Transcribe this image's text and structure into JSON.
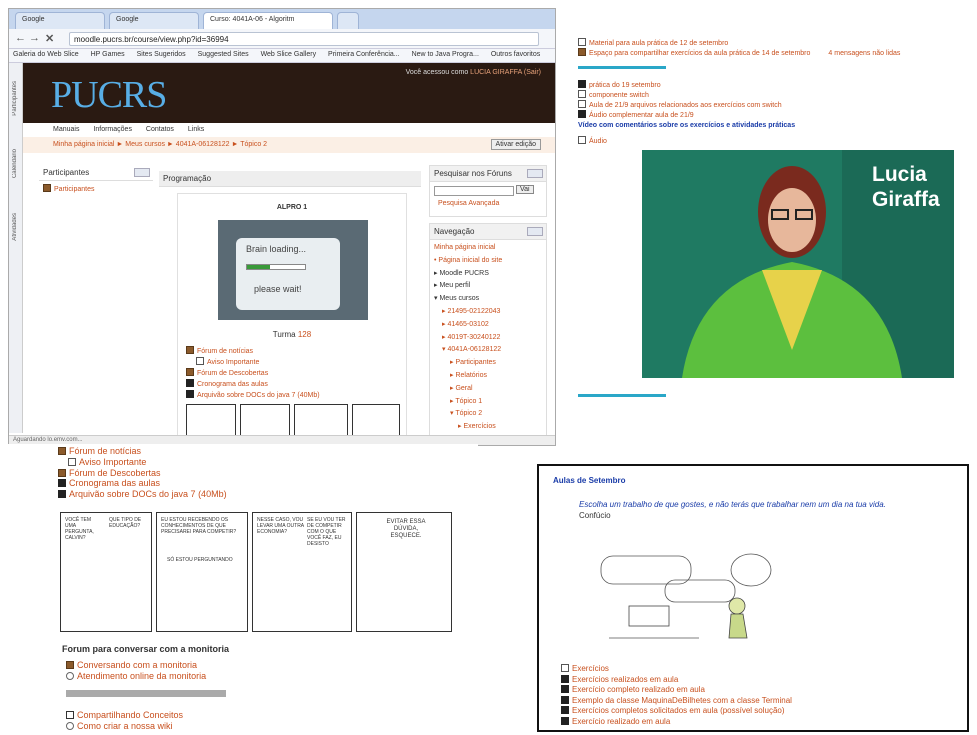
{
  "browser": {
    "tabs": [
      "Google",
      "Google",
      "Curso: 4041A-06 - Algoritm"
    ],
    "url": "moodle.pucrs.br/course/view.php?id=36994",
    "bookmarks": [
      "Galeria do Web Slice",
      "HP Games",
      "Sites Sugeridos",
      "Suggested Sites",
      "Web Slice Gallery",
      "Primeira Conferência...",
      "New to Java Progra...",
      "Outros favoritos"
    ],
    "side_tabs": [
      "Participantes",
      "Calendário",
      "Atividades"
    ],
    "logo": "PUCRS",
    "login_text": "Você acessou como",
    "login_user": "LUCIA GIRAFFA",
    "login_logout": "(Sair)",
    "menu": [
      "Manuais",
      "Informações",
      "Contatos",
      "Links"
    ],
    "breadcrumb": "Minha página inicial ► Meus cursos ► 4041A-06128122 ► Tópico 2",
    "edit_button": "Ativar edição",
    "participants_block": {
      "title": "Participantes",
      "item": "Participantes"
    },
    "programacao": {
      "title": "Programação",
      "course": "ALPRO 1",
      "loading_text": "Brain loading...",
      "wait_text": "please wait!",
      "turma_label": "Turma",
      "turma_number": "128",
      "items": [
        "Fórum de notícias",
        "Aviso Importante",
        "Fórum de Descobertas",
        "Cronograma das aulas",
        "Arquivão sobre DOCs do java 7 (40Mb)"
      ]
    },
    "search_block": {
      "title": "Pesquisar nos Fóruns",
      "button": "Vai",
      "advanced": "Pesquisa Avançada"
    },
    "nav_block": {
      "title": "Navegação",
      "items": [
        "Minha página inicial",
        "Página inicial do site",
        "Moodle PUCRS",
        "Meu perfil",
        "Meus cursos",
        "21495-02122043",
        "41465-03102",
        "4019T-30240122",
        "4041A-06128122",
        "Participantes",
        "Relatórios",
        "Geral",
        "Tópico 1",
        "Tópico 2",
        "Exercícios"
      ]
    },
    "status": "Aguardando lo.emv.com..."
  },
  "panel2": {
    "items": [
      "Material para aula prática de 12 de setembro",
      "Espaço para compartilhar exercícios da aula prática de 14 de setembro",
      "4 mensagens não lidas",
      "prática do 19 setembro",
      "componente switch",
      "Aula de 21/9 arquivos relacionados aos exercícios com switch",
      "Áudio complementar aula de 21/9"
    ],
    "video_heading": "Vídeo com comentários sobre os exercícios e atividades práticas",
    "audio": "Áudio",
    "presenter_first": "Lucia",
    "presenter_last": "Giraffa"
  },
  "panel3": {
    "items": [
      "Fórum de notícias",
      "Aviso Importante",
      "Fórum de Descobertas",
      "Cronograma das aulas",
      "Arquivão sobre DOCs do java 7 (40Mb)"
    ],
    "comic": [
      "VOCÊ TEM UMA PERGUNTA, CALVIN?",
      "QUE TIPO DE EDUCAÇÃO?",
      "EU ESTOU RECEBENDO OS CONHECIMENTOS DE QUE PRECISAREI PARA COMPETIR?",
      "SÓ ESTOU PERGUNTANDO",
      "NESSE CASO, VOU LEVAR UMA OUTRA ECONOMIA?",
      "SE EU VOU TER DE COMPETIR COM O QUE VOCÊ FAZ, EU DESISTO",
      "EVITAR ESSA DÚVIDA, ESQUECE."
    ],
    "forum_heading": "Forum para conversar com a monitoria",
    "forum_items": [
      "Conversando com a monitoria",
      "Atendimento online da monitoria"
    ],
    "bottom_items": [
      "Compartilhando Conceitos",
      "Como criar a nossa wiki"
    ]
  },
  "panel4": {
    "heading": "Aulas de Setembro",
    "quote": "Escolha um trabalho de que gostes, e não terás que trabalhar nem um dia na tua vida.",
    "author": "Confúcio",
    "items": [
      "Exercícios",
      "Exercícios realizados em aula",
      "Exercício completo realizado em aula",
      "Exemplo da classe MaquinaDeBilhetes com a classe Terminal",
      "Exercícios completos solicitados em aula (possível solução)",
      "Exercício realizado em aula"
    ]
  }
}
